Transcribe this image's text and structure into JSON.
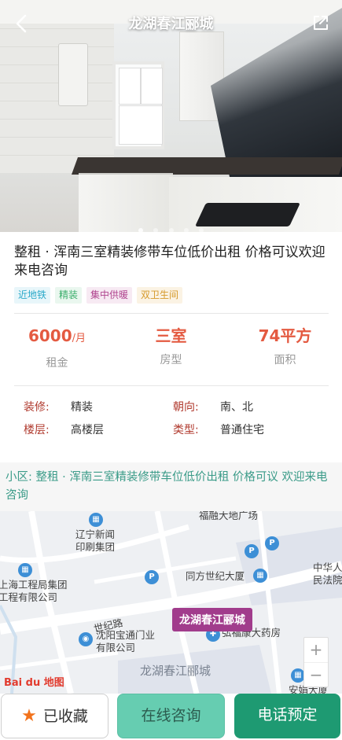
{
  "header": {
    "title": "龙湖春江郦城"
  },
  "gallery": {
    "dots": 5,
    "active": 0
  },
  "listing": {
    "headline": "整租 · 浑南三室精装修带车位低价出租 价格可议欢迎来电咨询",
    "tags": [
      {
        "label": "近地铁",
        "color": "#2aa9c9",
        "bg": "#e8f6fa"
      },
      {
        "label": "精装",
        "color": "#3aae6b",
        "bg": "#eaf7ef"
      },
      {
        "label": "集中供暖",
        "color": "#b0458f",
        "bg": "#f7eaf3"
      },
      {
        "label": "双卫生间",
        "color": "#d69a2c",
        "bg": "#fbf3e4"
      }
    ],
    "stats": [
      {
        "value": "6000",
        "unit": "/月",
        "label": "租金"
      },
      {
        "value": "三室",
        "unit": "",
        "label": "房型"
      },
      {
        "value": "74平方",
        "unit": "",
        "label": "面积"
      }
    ],
    "attributes": [
      {
        "key": "装修:",
        "value": "精装"
      },
      {
        "key": "朝向:",
        "value": "南、北"
      },
      {
        "key": "楼层:",
        "value": "高楼层"
      },
      {
        "key": "类型:",
        "value": "普通住宅"
      }
    ],
    "community": "小区: 整租 · 浑南三室精装修带车位低价出租 价格可议 欢迎来电咨询"
  },
  "map": {
    "pin_label": "龙湖春江郦城",
    "labels": {
      "l1": "福融大地广场",
      "l2": "辽宁新闻",
      "l3": "印刷集团",
      "l4": "上海工程局集团",
      "l5": "工程有限公司",
      "l6": "世纪路",
      "l7": "同方世纪大厦",
      "l8": "中华人",
      "l9": "民法院",
      "l10": "沈阳宝通门业",
      "l11": "有限公司",
      "l12": "弘福康大药房",
      "l13": "龙湖春江郦城",
      "l14": "安娟大厦"
    },
    "zoom_in": "+",
    "zoom_out": "−",
    "provider": "Bai du 地图"
  },
  "actions": {
    "favorite": "已收藏",
    "chat": "在线咨询",
    "call": "电话预定"
  }
}
